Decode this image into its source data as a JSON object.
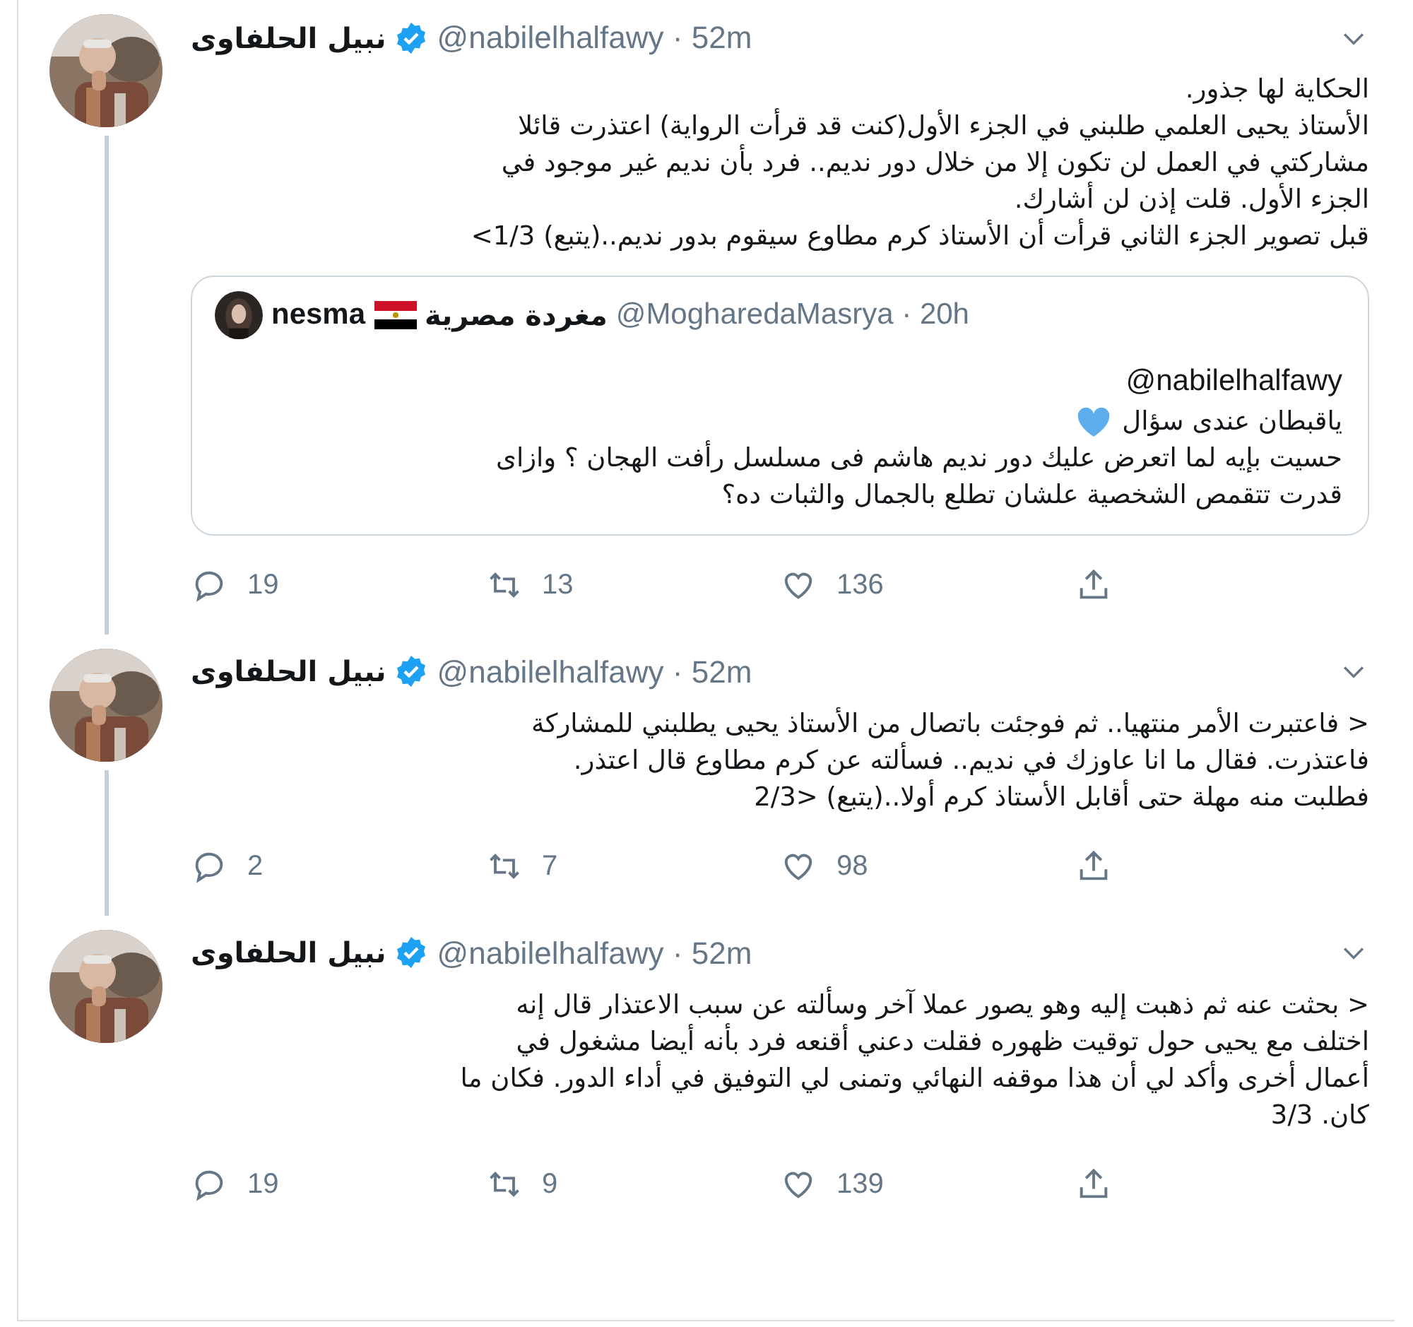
{
  "tweets": [
    {
      "name": "نبيل الحلفاوى",
      "verified": true,
      "handle": "@nabilelhalfawy · 52m",
      "text": "الحكاية لها جذور.\nالأستاذ يحيى العلمي طلبني في الجزء الأول(كنت قد قرأت الرواية) اعتذرت قائلا\nمشاركتي في العمل لن تكون إلا من خلال دور نديم.. فرد بأن نديم غير موجود في\nالجزء الأول. قلت إذن لن أشارك.\nقبل تصوير الجزء الثاني قرأت أن الأستاذ كرم مطاوع سيقوم بدور نديم..(يتبع) 1/3>",
      "thread_line": true,
      "quote": {
        "name_latin": "nesma",
        "name_arabic": "مغردة مصرية",
        "handle": "@MogharedaMasrya · 20h",
        "mention": "@nabilelhalfawy",
        "line_with_heart": "ياقبطان عندى سؤال",
        "text": "حسيت بإيه لما اتعرض عليك دور نديم هاشم فى مسلسل رأفت الهجان ؟ وازاى\nقدرت تتقمص الشخصية علشان تطلع بالجمال والثبات ده؟"
      },
      "replies": "19",
      "retweets": "13",
      "likes": "136"
    },
    {
      "name": "نبيل الحلفاوى",
      "verified": true,
      "handle": "@nabilelhalfawy · 52m",
      "text": "< فاعتبرت الأمر منتهيا.. ثم فوجئت باتصال من الأستاذ يحيى يطلبني للمشاركة\nفاعتذرت. فقال ما انا عاوزك في نديم.. فسألته عن كرم مطاوع قال اعتذر.\nفطلبت منه مهلة حتى أقابل الأستاذ كرم أولا..(يتبع) <2/3",
      "thread_line": true,
      "replies": "2",
      "retweets": "7",
      "likes": "98"
    },
    {
      "name": "نبيل الحلفاوى",
      "verified": true,
      "handle": "@nabilelhalfawy · 52m",
      "text": "< بحثت عنه ثم ذهبت إليه وهو يصور عملا آخر وسألته عن سبب الاعتذار قال إنه\nاختلف مع يحيى حول توقيت ظهوره فقلت دعني أقنعه فرد بأنه أيضا مشغول في\nأعمال أخرى وأكد لي أن هذا موقفه النهائي وتمنى لي التوفيق في أداء الدور. فكان ما\nكان. 3/3",
      "thread_line": false,
      "replies": "19",
      "retweets": "9",
      "likes": "139"
    }
  ]
}
